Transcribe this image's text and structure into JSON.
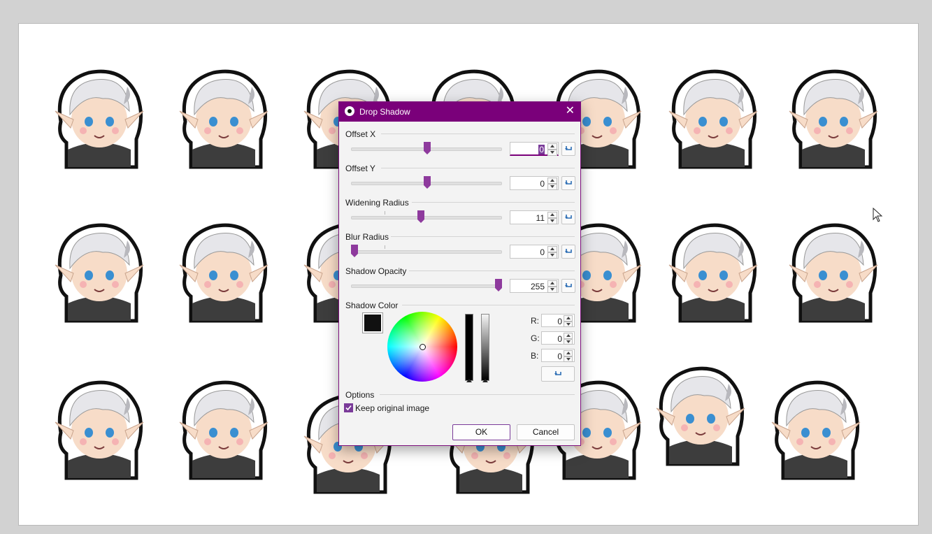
{
  "dialog": {
    "title": "Drop Shadow",
    "close_glyph": "✕"
  },
  "controls": [
    {
      "label": "Offset X",
      "value": "0"
    },
    {
      "label": "Offset Y",
      "value": "0"
    },
    {
      "label": "Widening Radius",
      "value": "11"
    },
    {
      "label": "Blur Radius",
      "value": "0"
    },
    {
      "label": "Shadow Opacity",
      "value": "255"
    }
  ],
  "color": {
    "section_label": "Shadow Color",
    "swatch": "#111111",
    "r_label": "R:",
    "r_value": "0",
    "g_label": "G:",
    "g_value": "0",
    "b_label": "B:",
    "b_value": "0"
  },
  "options": {
    "section_label": "Options",
    "keep_original_label": "Keep original image",
    "keep_original_checked": true
  },
  "buttons": {
    "ok": "OK",
    "cancel": "Cancel"
  },
  "theme": {
    "accent": "#7a007a",
    "thumb": "#8e3a9d"
  }
}
